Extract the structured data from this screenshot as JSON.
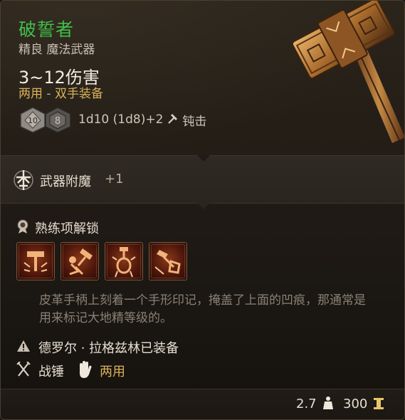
{
  "item": {
    "name": "破誓者",
    "rarity_type": "精良 魔法武器",
    "damage": "3~12伤害",
    "handedness": "两用",
    "handedness_sep": " - ",
    "equip_slot": "双手装备",
    "dice": {
      "first": "10",
      "second": "8"
    },
    "roll_formula": "1d10 (1d8)+2",
    "damage_type": "钝击"
  },
  "enchantment": {
    "label": "武器附魔",
    "bonus": "+1"
  },
  "proficiency": {
    "title": "熟练项解锁",
    "actions": [
      "action-1",
      "action-2",
      "action-3",
      "action-4"
    ]
  },
  "description": "皮革手柄上刻着一个手形印记，掩盖了上面的凹痕，那通常是用来标记大地精等级的。",
  "equipped_notice": "德罗尔 · 拉格兹林已装备",
  "weapon_type": "战锤",
  "weapon_property": "两用",
  "footer": {
    "weight": "2.7",
    "value": "300"
  },
  "colors": {
    "name": "#3fbf4a",
    "accent": "#d9b25a",
    "description": "#8a8175"
  }
}
